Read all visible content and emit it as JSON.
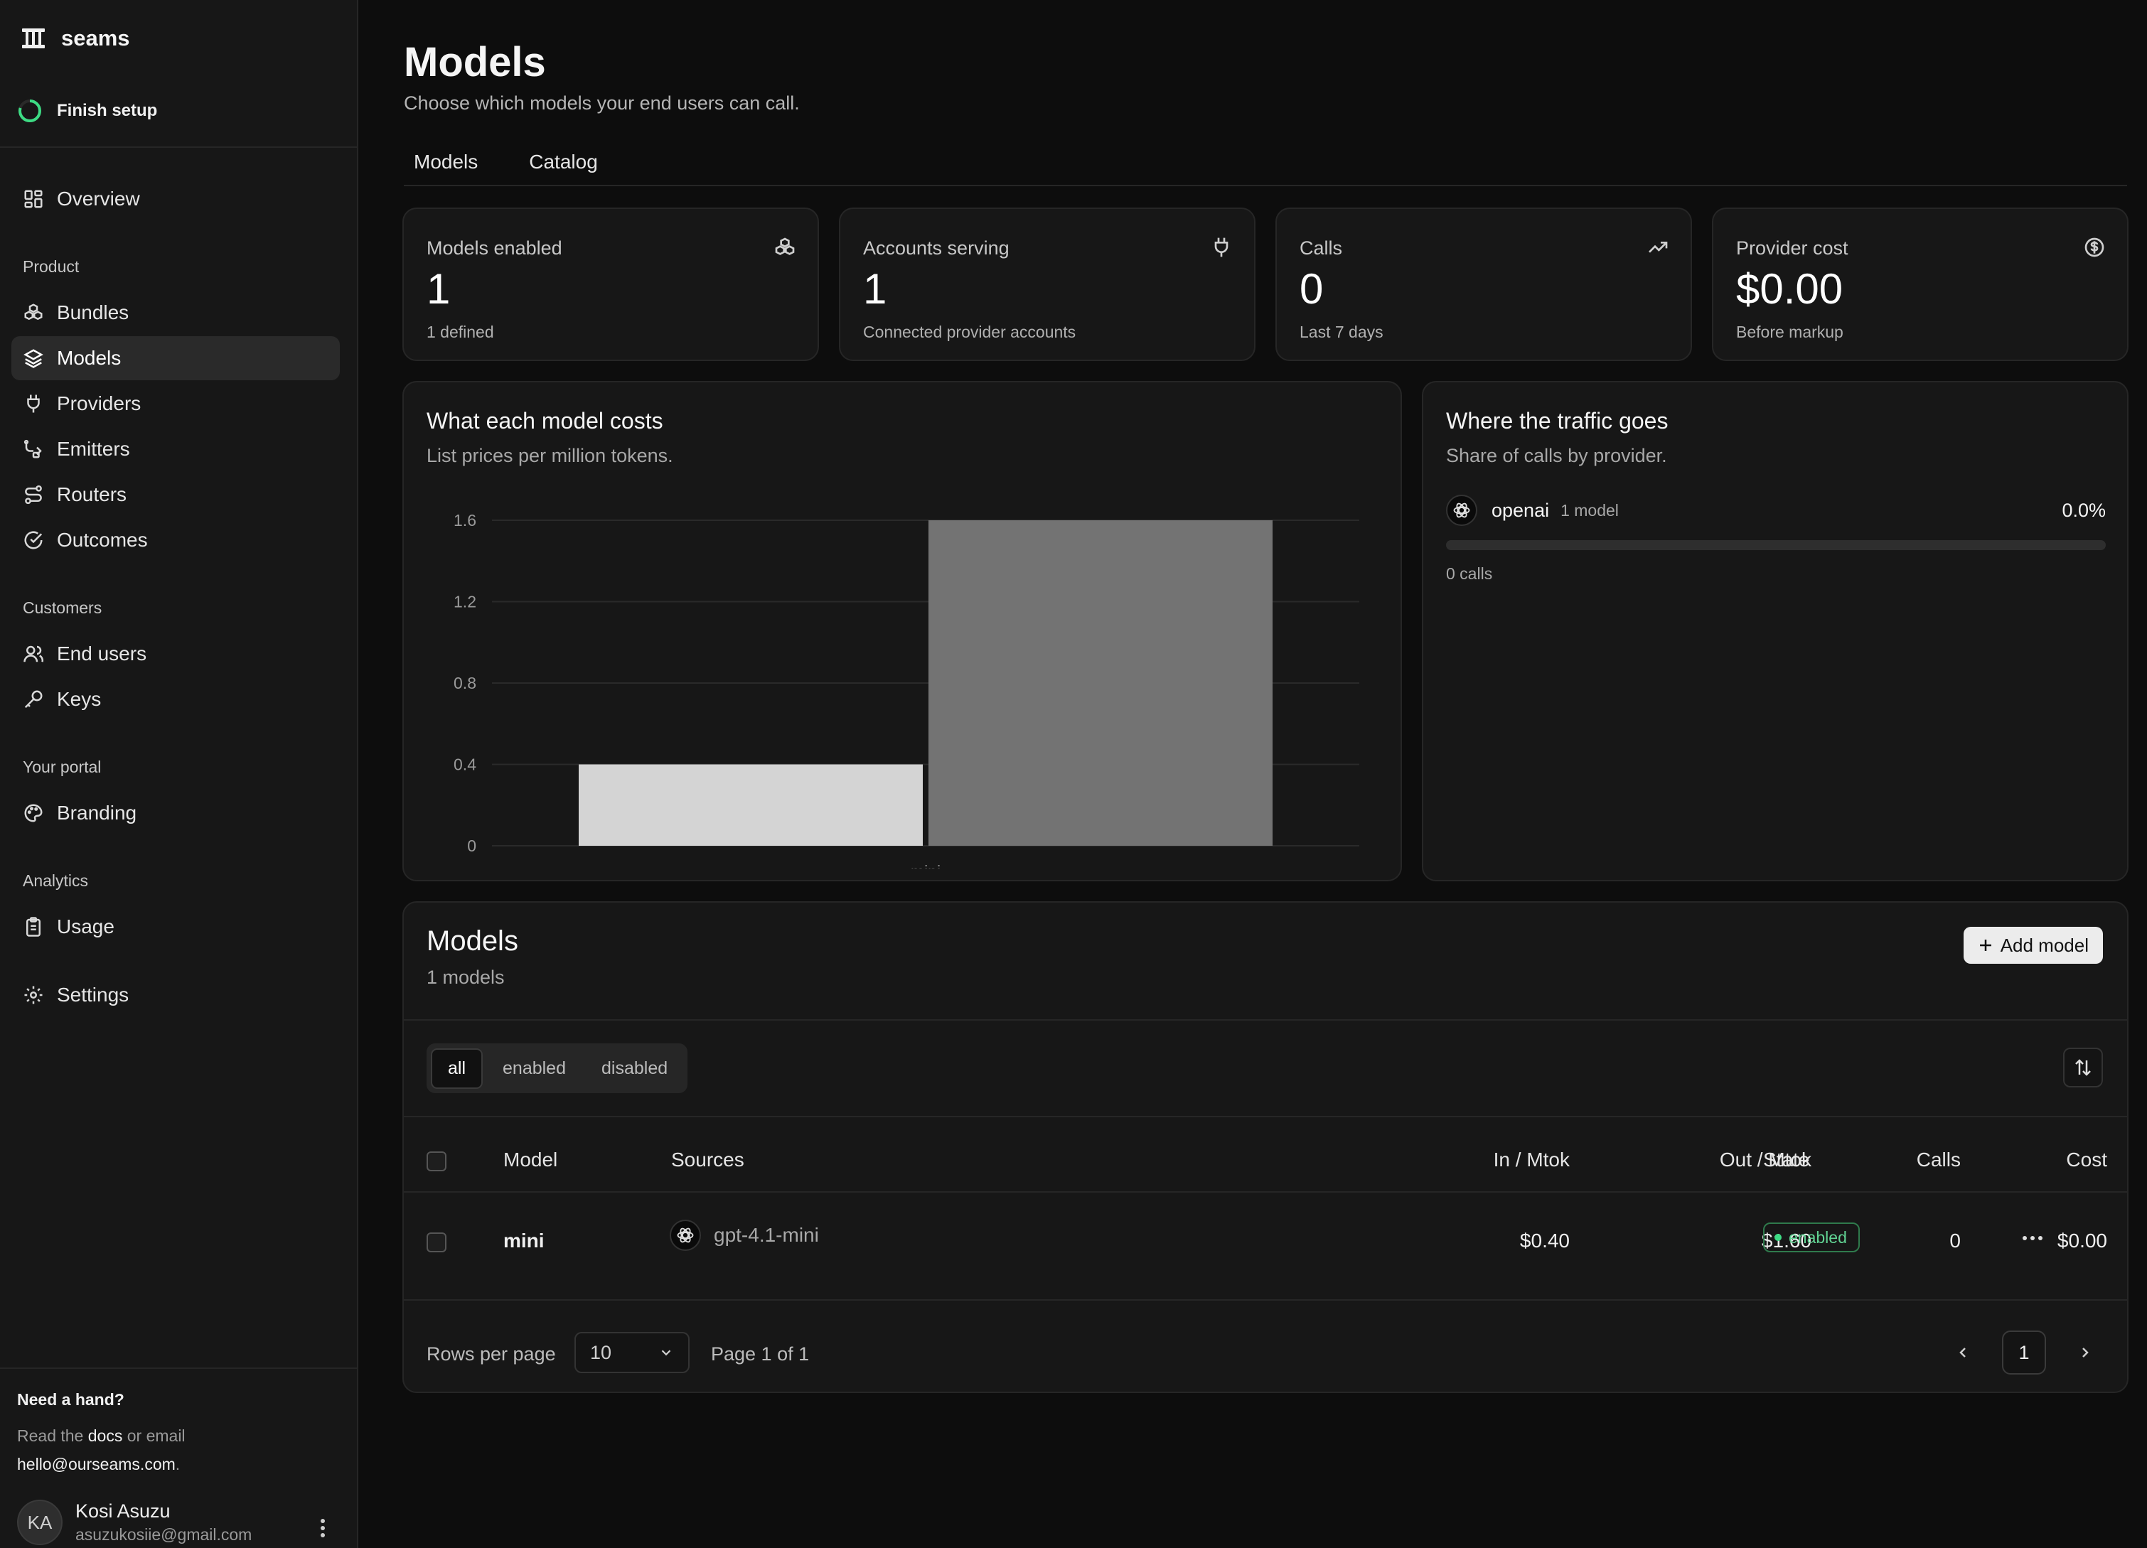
{
  "sidebar": {
    "brand": "seams",
    "setup_label": "Finish setup",
    "overview": "Overview",
    "groups": {
      "product": "Product",
      "customers": "Customers",
      "portal": "Your portal",
      "analytics": "Analytics"
    },
    "items": {
      "bundles": "Bundles",
      "models": "Models",
      "providers": "Providers",
      "emitters": "Emitters",
      "routers": "Routers",
      "outcomes": "Outcomes",
      "end_users": "End users",
      "keys": "Keys",
      "branding": "Branding",
      "usage": "Usage",
      "settings": "Settings"
    },
    "active_item": "models",
    "help": {
      "title": "Need a hand?",
      "prefix": "Read the ",
      "docs": "docs",
      "middle": " or email",
      "email": "hello@ourseams.com",
      "suffix": "."
    },
    "user": {
      "initials": "KA",
      "name": "Kosi Asuzu",
      "email": "asuzukosiie@gmail.com"
    }
  },
  "header": {
    "title": "Models",
    "subtitle": "Choose which models your end users can call.",
    "tabs": [
      "Models",
      "Catalog"
    ]
  },
  "stats": [
    {
      "label": "Models enabled",
      "value": "1",
      "sub": "1 defined",
      "icon": "bundles-icon"
    },
    {
      "label": "Accounts serving",
      "value": "1",
      "sub": "Connected provider accounts",
      "icon": "plug-icon"
    },
    {
      "label": "Calls",
      "value": "0",
      "sub": "Last 7 days",
      "icon": "trending-up-icon"
    },
    {
      "label": "Provider cost",
      "value": "$0.00",
      "sub": "Before markup",
      "icon": "dollar-circle-icon"
    }
  ],
  "cost_card": {
    "title": "What each model costs",
    "subtitle": "List prices per million tokens."
  },
  "chart_data": {
    "type": "bar",
    "categories": [
      "mini"
    ],
    "series": [
      {
        "name": "In / Mtok",
        "values": [
          0.4
        ],
        "color": "#d4d4d4"
      },
      {
        "name": "Out / Mtok",
        "values": [
          1.6
        ],
        "color": "#737373"
      }
    ],
    "yticks": [
      "0",
      "0.4",
      "0.8",
      "1.2",
      "1.6"
    ],
    "ylim": [
      0,
      1.6
    ],
    "grid": true
  },
  "traffic_card": {
    "title": "Where the traffic goes",
    "subtitle": "Share of calls by provider.",
    "provider": "openai",
    "provider_models": "1 model",
    "share_label": "0.0%",
    "share": 0,
    "calls": "0 calls"
  },
  "models_table": {
    "title": "Models",
    "count": "1 models",
    "add_button": "Add model",
    "filters": [
      "all",
      "enabled",
      "disabled"
    ],
    "active_filter": "all",
    "columns": [
      "Model",
      "Sources",
      "In / Mtok",
      "Out / Mtok",
      "Calls",
      "Cost",
      "State"
    ],
    "rows": [
      {
        "model": "mini",
        "source": "gpt-4.1-mini",
        "in": "$0.40",
        "out": "$1.60",
        "calls": "0",
        "cost": "$0.00",
        "state": "enabled"
      }
    ],
    "rows_per_page_label": "Rows per page",
    "rows_per_page": "10",
    "page_label": "Page 1 of 1",
    "current_page": "1"
  },
  "colors": {
    "background": "#0d0d0d",
    "surface": "#171717",
    "border": "#262626",
    "accent_green": "#3ddc84"
  }
}
